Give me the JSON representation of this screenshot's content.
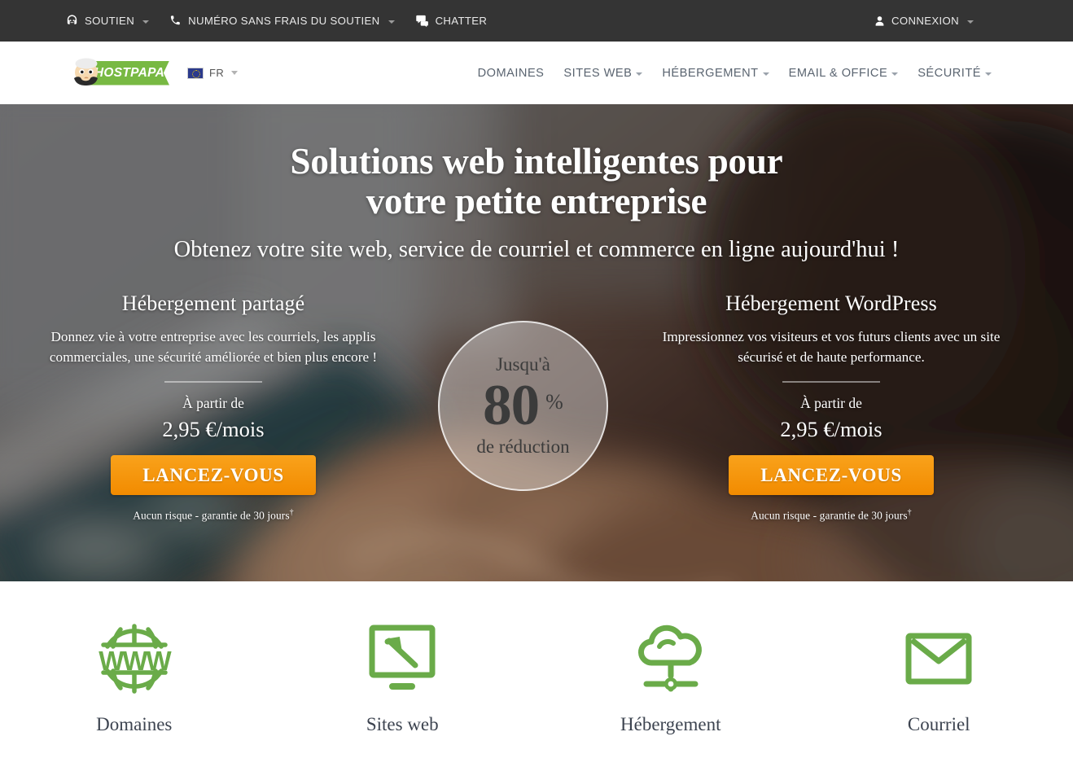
{
  "topbar": {
    "items": [
      {
        "label": "SOUTIEN",
        "icon": "support-agent-icon",
        "caret": true
      },
      {
        "label": "NUMÉRO SANS FRAIS DU SOUTIEN",
        "icon": "phone-icon",
        "caret": true
      },
      {
        "label": "CHATTER",
        "icon": "chat-bubbles-icon",
        "caret": false
      }
    ],
    "account": {
      "label": "CONNEXION",
      "icon": "user-icon",
      "caret": true
    },
    "background_color": "#343434",
    "text_color": "#e9e9e9"
  },
  "header": {
    "logo": {
      "text": "HOSTPAPA",
      "icon": "hostpapa-papa-face-icon",
      "color": "#78b943"
    },
    "language": {
      "label": "FR",
      "flag": "eu-flag-icon"
    },
    "nav": [
      {
        "label": "DOMAINES",
        "caret": false
      },
      {
        "label": "SITES WEB",
        "caret": true
      },
      {
        "label": "HÉBERGEMENT",
        "caret": true
      },
      {
        "label": "EMAIL & OFFICE",
        "caret": true
      },
      {
        "label": "SÉCURITÉ",
        "caret": true
      }
    ]
  },
  "hero": {
    "title_line1": "Solutions web intelligentes pour",
    "title_line2": "votre petite entreprise",
    "subtitle": "Obtenez votre site web, service de courriel et commerce en ligne aujourd'hui !",
    "badge": {
      "top": "Jusqu'à",
      "number": "80",
      "percent": "%",
      "bottom": "de réduction"
    },
    "cards": [
      {
        "title": "Hébergement partagé",
        "description": "Donnez vie à votre entreprise avec les courriels, les applis commerciales, une sécurité améliorée et bien plus encore !",
        "from_label": "À partir de",
        "price": "2,95 €/mois",
        "cta_label": "LANCEZ-VOUS",
        "guarantee": "Aucun risque - garantie de 30 jours",
        "guarantee_marker": "†"
      },
      {
        "title": "Hébergement WordPress",
        "description": "Impressionnez vos visiteurs et vos futurs clients avec un site sécurisé et de haute performance.",
        "from_label": "À partir de",
        "price": "2,95 €/mois",
        "cta_label": "LANCEZ-VOUS",
        "guarantee": "Aucun risque - garantie de 30 jours",
        "guarantee_marker": "†"
      }
    ],
    "cta_color": "#f39200"
  },
  "features": {
    "accent_color": "#6aab49",
    "items": [
      {
        "label": "Domaines",
        "icon": "www-globe-icon"
      },
      {
        "label": "Sites web",
        "icon": "monitor-hammer-icon"
      },
      {
        "label": "Hébergement",
        "icon": "cloud-network-icon"
      },
      {
        "label": "Courriel",
        "icon": "envelope-icon"
      }
    ]
  }
}
